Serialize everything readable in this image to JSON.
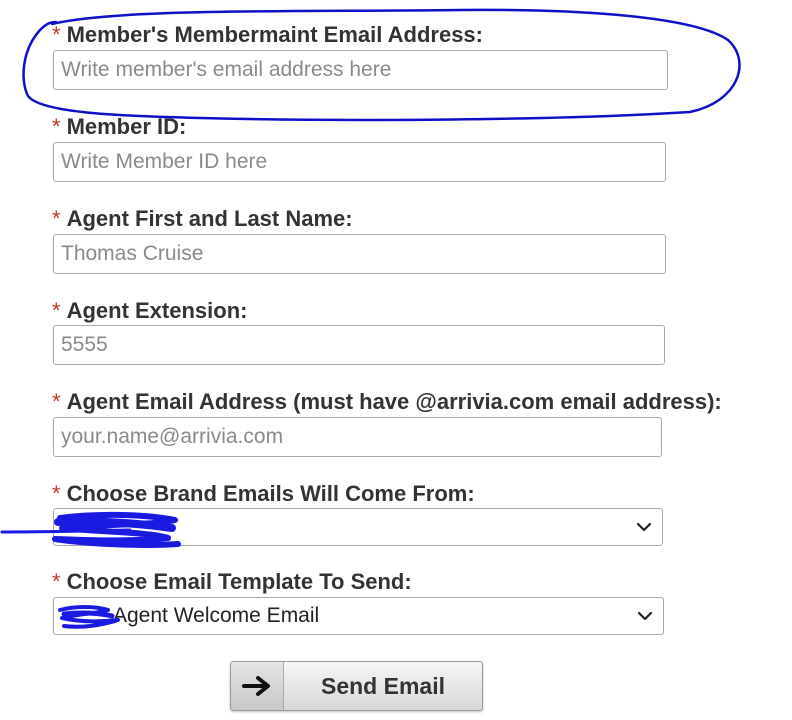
{
  "form": {
    "required_marker": "*",
    "member_email": {
      "label": "Member's Membermaint Email Address:",
      "placeholder": "Write member's email address here",
      "value": ""
    },
    "member_id": {
      "label": "Member ID:",
      "placeholder": "Write Member ID here",
      "value": ""
    },
    "agent_name": {
      "label": "Agent First and Last Name:",
      "placeholder": "Thomas Cruise",
      "value": ""
    },
    "agent_extension": {
      "label": "Agent Extension:",
      "placeholder": "5555",
      "value": ""
    },
    "agent_email": {
      "label": "Agent Email Address (must have @arrivia.com email address):",
      "placeholder": "your.name@arrivia.com",
      "value": ""
    },
    "brand": {
      "label": "Choose Brand Emails Will Come From:",
      "selected": ""
    },
    "template": {
      "label": "Choose Email Template To Send:",
      "selected": "Agent Welcome Email"
    },
    "send_button": {
      "label": "Send Email",
      "icon": "arrow-right-icon"
    }
  },
  "annotations": {
    "highlight_color": "#1010c8",
    "redaction_color": "#1a1ae0"
  }
}
